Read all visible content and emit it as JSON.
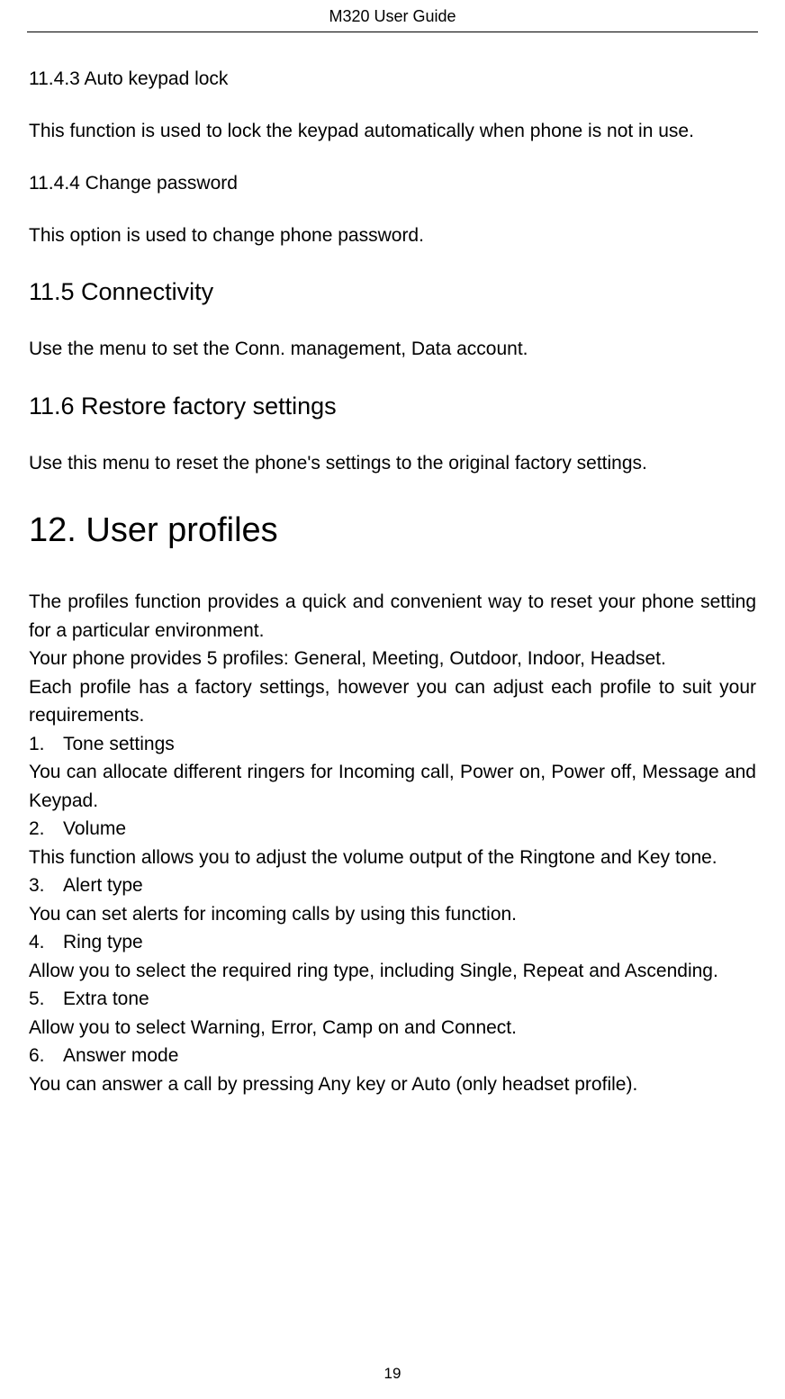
{
  "header": {
    "title": "M320 User Guide"
  },
  "sections": {
    "s11_4_3": {
      "heading": "11.4.3 Auto keypad lock",
      "body": "This function is used to lock the keypad automatically when phone is not in use."
    },
    "s11_4_4": {
      "heading": "11.4.4 Change password",
      "body": "This option is used to change phone password."
    },
    "s11_5": {
      "heading": "11.5 Connectivity",
      "body": "Use the menu to set the Conn. management, Data account."
    },
    "s11_6": {
      "heading": "11.6 Restore factory settings",
      "body": "Use this menu to reset the phone's settings to the original factory settings."
    },
    "s12": {
      "heading": "12. User profiles",
      "intro1": "The profiles function provides a quick and convenient way to reset your phone setting for a particular environment.",
      "intro2": "Your phone provides 5 profiles: General, Meeting, Outdoor, Indoor, Headset.",
      "intro3": "Each profile has a factory settings, however you can adjust each profile to suit your requirements.",
      "items": [
        {
          "num": "1.",
          "title": "Tone settings",
          "body": "You can allocate different ringers for Incoming call, Power on, Power off, Message and Keypad."
        },
        {
          "num": "2.",
          "title": "Volume",
          "body": "This function allows you to adjust the volume output of the Ringtone and Key tone."
        },
        {
          "num": "3.",
          "title": "Alert type",
          "body": "You can set alerts for incoming calls by using this function."
        },
        {
          "num": "4.",
          "title": "Ring type",
          "body": "Allow you to select the required ring type, including Single, Repeat and Ascending."
        },
        {
          "num": "5.",
          "title": "Extra tone",
          "body": "Allow you to select Warning, Error, Camp on and Connect."
        },
        {
          "num": "6.",
          "title": "Answer mode",
          "body": "You can answer a call by pressing Any key or Auto (only headset profile)."
        }
      ]
    }
  },
  "page_number": "19"
}
